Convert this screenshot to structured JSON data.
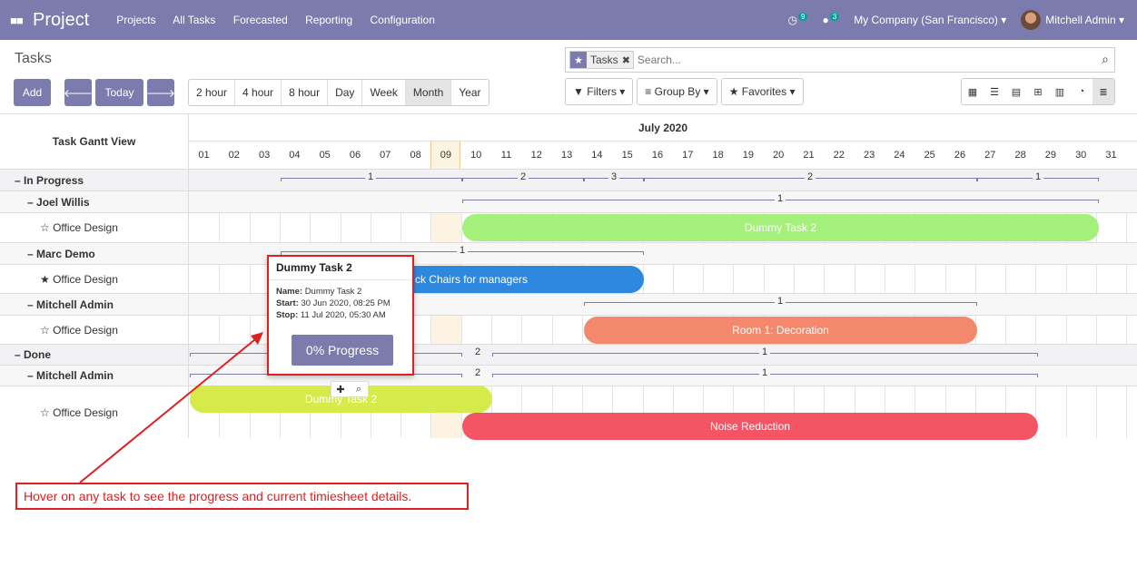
{
  "navbar": {
    "app_icon": "apps-grid-icon",
    "brand": "Project",
    "menu": [
      "Projects",
      "All Tasks",
      "Forecasted",
      "Reporting",
      "Configuration"
    ],
    "activity_badge": "9",
    "messages_badge": "3",
    "company": "My Company (San Francisco)",
    "user": "Mitchell Admin"
  },
  "control": {
    "title": "Tasks",
    "add": "Add",
    "today": "Today",
    "scales": [
      "2 hour",
      "4 hour",
      "8 hour",
      "Day",
      "Week",
      "Month",
      "Year"
    ],
    "active_scale": "Month",
    "facet": "Tasks",
    "search_placeholder": "Search...",
    "filters": "Filters",
    "group_by": "Group By",
    "favorites": "Favorites"
  },
  "gantt": {
    "header_label": "Task Gantt View",
    "month": "July 2020",
    "days": [
      "01",
      "02",
      "03",
      "04",
      "05",
      "06",
      "07",
      "08",
      "09",
      "10",
      "11",
      "12",
      "13",
      "14",
      "15",
      "16",
      "17",
      "18",
      "19",
      "20",
      "21",
      "22",
      "23",
      "24",
      "25",
      "26",
      "27",
      "28",
      "29",
      "30",
      "31"
    ],
    "today_index": 8,
    "rows": [
      {
        "label": "In Progress",
        "level": 0
      },
      {
        "label": "Joel Willis",
        "level": 1
      },
      {
        "label": "Office Design",
        "level": 2,
        "starred": false
      },
      {
        "label": "Marc Demo",
        "level": 1
      },
      {
        "label": "Office Design",
        "level": 2,
        "starred": true
      },
      {
        "label": "Mitchell Admin",
        "level": 1
      },
      {
        "label": "Office Design",
        "level": 2,
        "starred": false
      },
      {
        "label": "Done",
        "level": 0
      },
      {
        "label": "Mitchell Admin",
        "level": 1
      },
      {
        "label": "Office Design",
        "level": 2,
        "starred": false
      }
    ],
    "tasks": {
      "dummy2_a": "Dummy Task 2",
      "chairs": "Buy Desk Chairs for managers",
      "chairs_visible": "ck Chairs for managers",
      "room": "Room 1: Decoration",
      "dummy2_b": "Dummy Task 2",
      "noise": "Noise Reduction"
    },
    "consolidation": {
      "in_progress": [
        "1",
        "2",
        "3",
        "2",
        "1"
      ],
      "joel": [
        "1"
      ],
      "marc": [
        "1"
      ],
      "mitchell": [
        "1"
      ],
      "done": [
        "2",
        "1"
      ],
      "done_mitchell": [
        "2",
        "1"
      ]
    }
  },
  "popover": {
    "title": "Dummy Task 2",
    "name_label": "Name:",
    "name": "Dummy Task 2",
    "start_label": "Start:",
    "start": "30 Jun 2020, 08:25 PM",
    "stop_label": "Stop:",
    "stop": "11 Jul 2020, 05:30 AM",
    "progress_button": "0% Progress"
  },
  "callout": "Hover on any task to see the progress and current timiesheet details.",
  "colors": {
    "brand": "#7c7bad",
    "green": "#a5f07a",
    "blue": "#2e88de",
    "orange": "#f3886c",
    "yellow_green": "#d6ea4a",
    "red": "#f45565",
    "annotation": "#e02020"
  }
}
